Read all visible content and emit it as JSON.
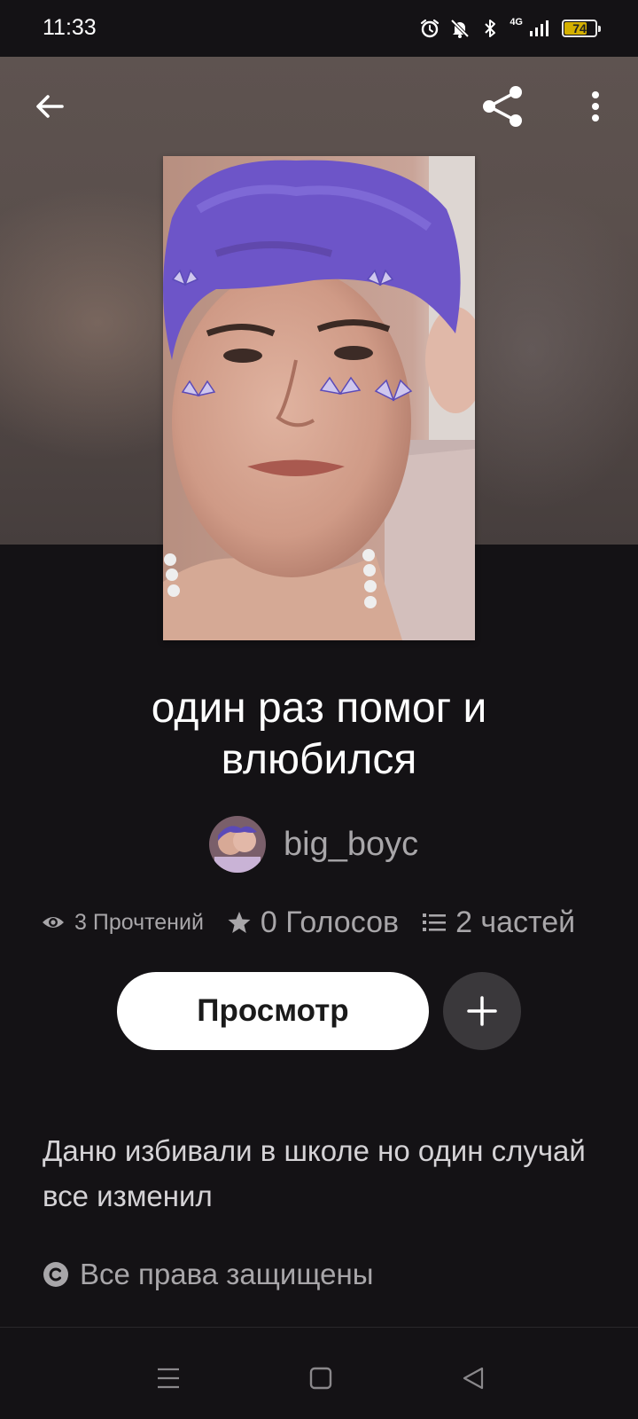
{
  "status_bar": {
    "time": "11:33",
    "network_label": "4G",
    "battery_level": "74",
    "icons": [
      "alarm-icon",
      "mute-icon",
      "bluetooth-icon",
      "signal-icon",
      "battery-icon"
    ]
  },
  "topbar": {
    "icons": [
      "back-arrow-icon",
      "share-icon",
      "more-vert-icon"
    ]
  },
  "story": {
    "title": "один раз помог и влюбился",
    "author": "big_boyc",
    "stats": {
      "reads": "3 Прочтений",
      "votes": "0 Голосов",
      "parts": "2 частей"
    },
    "read_button": "Просмотр",
    "description": "Даню избивали в школе но один случай все изменил",
    "copyright": "Все права защищены"
  },
  "colors": {
    "background": "#141215",
    "muted_text": "#a8a6a9",
    "button_bg": "#ffffff",
    "add_button_bg": "#3a383b",
    "battery_fill": "#d4b000"
  },
  "nav_bar": {
    "icons": [
      "menu-icon",
      "home-icon",
      "back-icon"
    ]
  }
}
